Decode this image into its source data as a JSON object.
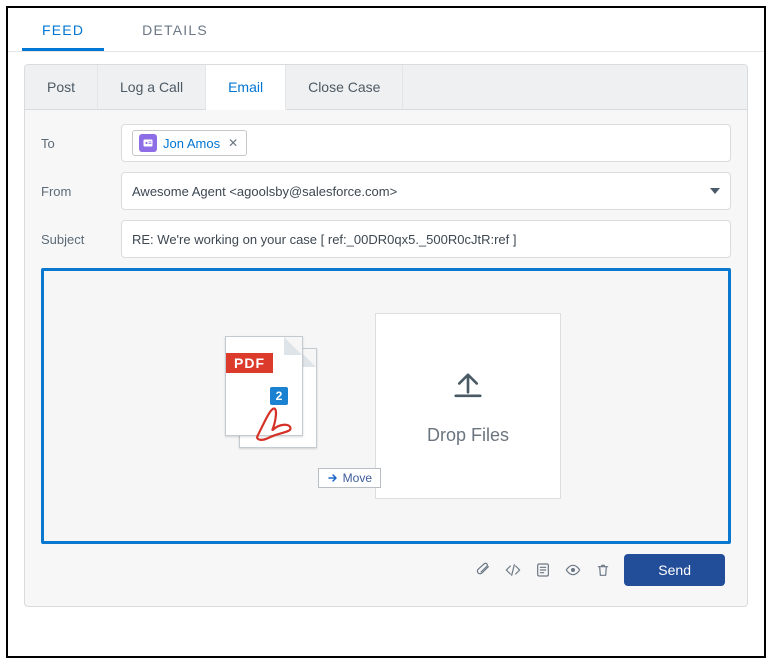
{
  "top_tabs": {
    "feed": "FEED",
    "details": "DETAILS"
  },
  "publisher_tabs": {
    "post": "Post",
    "log_call": "Log a Call",
    "email": "Email",
    "close_case": "Close Case"
  },
  "labels": {
    "to": "To",
    "from": "From",
    "subject": "Subject"
  },
  "email": {
    "to_recipient": "Jon Amos",
    "from_value": "Awesome Agent <agoolsby@salesforce.com>",
    "subject_value": "RE: We're working on your case    [ ref:_00DR0qx5._500R0cJtR:ref ]"
  },
  "attachment": {
    "type": "PDF",
    "count": "2",
    "cursor_action": "Move"
  },
  "dropzone": {
    "label": "Drop Files"
  },
  "footer": {
    "send": "Send"
  }
}
